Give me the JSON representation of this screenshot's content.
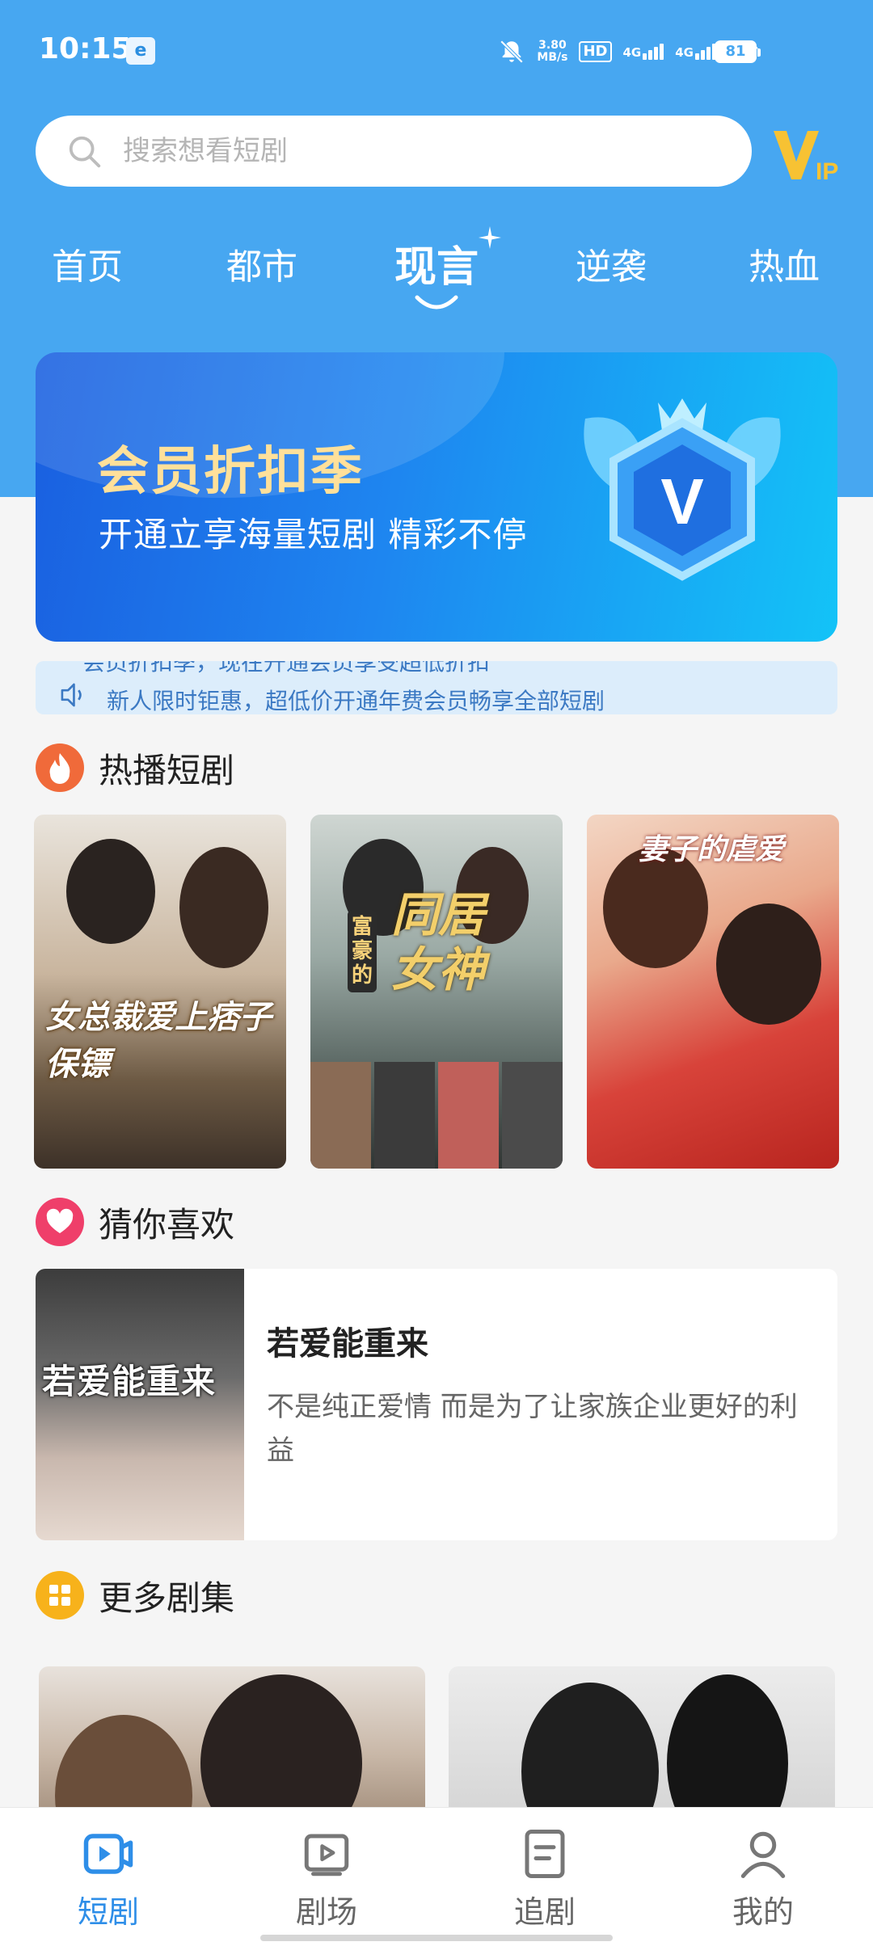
{
  "status_bar": {
    "time": "10:15",
    "net_speed_value": "3.80",
    "net_speed_unit": "MB/s",
    "hd_label": "HD",
    "sim1": "4G",
    "sim2": "4G",
    "battery": "81"
  },
  "search": {
    "placeholder": "搜索想看短剧"
  },
  "vip_badge": "VIP",
  "tabs": [
    {
      "label": "首页",
      "active": false
    },
    {
      "label": "都市",
      "active": false
    },
    {
      "label": "现言",
      "active": true
    },
    {
      "label": "逆袭",
      "active": false
    },
    {
      "label": "热血",
      "active": false
    }
  ],
  "banner": {
    "title": "会员折扣季",
    "subtitle": "开通立享海量短剧  精彩不停",
    "emblem_letter": "V"
  },
  "notice": {
    "previous_text": "会员折扣季，现在开通会员享受超低折扣",
    "text": "新人限时钜惠，超低价开通年费会员畅享全部短剧"
  },
  "sections": {
    "hot": "热播短剧",
    "guess": "猜你喜欢",
    "more": "更多剧集"
  },
  "hot_dramas": [
    {
      "poster_text": "女总裁爱上痞子保镖"
    },
    {
      "poster_text_small": "富豪的",
      "poster_text_big": "同居女神"
    },
    {
      "poster_text": "妻子的虐爱"
    }
  ],
  "guess_item": {
    "poster_text": "若爱能重来",
    "title": "若爱能重来",
    "description": "不是纯正爱情 而是为了让家族企业更好的利益"
  },
  "bottom_nav": [
    {
      "label": "短剧",
      "icon": "short-drama-icon",
      "active": true
    },
    {
      "label": "剧场",
      "icon": "theater-icon",
      "active": false
    },
    {
      "label": "追剧",
      "icon": "follow-icon",
      "active": false
    },
    {
      "label": "我的",
      "icon": "profile-icon",
      "active": false
    }
  ],
  "colors": {
    "header_blue": "#47a7f1",
    "accent_blue": "#2e8ee8",
    "banner_gold": "#ffe09a"
  }
}
